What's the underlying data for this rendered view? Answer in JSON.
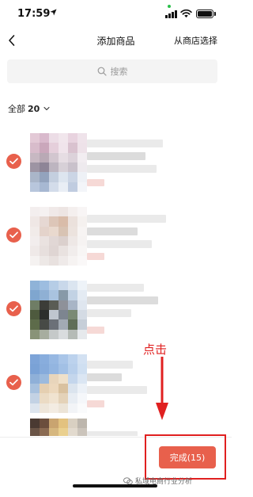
{
  "status_bar": {
    "time": "17:59"
  },
  "nav": {
    "title": "添加商品",
    "right_action": "从商店选择"
  },
  "search": {
    "placeholder": "搜索"
  },
  "filter": {
    "label": "全部",
    "count": "20"
  },
  "products": [
    {
      "selected": true,
      "thumb_colors": [
        "#e3c9d6",
        "#d9b9cc",
        "#ecdde6",
        "#f1e6ec",
        "#e8d3df",
        "#efe3ea",
        "#d8bccb",
        "#caa7bb",
        "#e5cfdb",
        "#f0e4eb",
        "#d9c2cf",
        "#eee2e9",
        "#c7b8c2",
        "#b9a9b5",
        "#d2c6cf",
        "#e6dde3",
        "#dcd2da",
        "#f2edf1",
        "#9d94a3",
        "#8e8597",
        "#bdb5c0",
        "#d7d0d7",
        "#c9c1cb",
        "#eeeaee",
        "#aab6c9",
        "#93a3bd",
        "#c4cfdf",
        "#dde5ef",
        "#cbd5e5",
        "#eef1f6",
        "#b8c6dc",
        "#a7b8d2",
        "#d3dcea",
        "#e9eef5",
        "#c0cce0",
        "#f3f5f9"
      ]
    },
    {
      "selected": true,
      "thumb_colors": [
        "#f3eeee",
        "#f5f1f1",
        "#f0e9e8",
        "#ede5e3",
        "#f4efee",
        "#f8f5f5",
        "#efe7e5",
        "#e6d8d3",
        "#ddc6b8",
        "#d9bca9",
        "#ebe1dc",
        "#f5f1ef",
        "#f1ebe9",
        "#e4d3cb",
        "#e9d9ce",
        "#d8c3b3",
        "#ece3de",
        "#f7f4f3",
        "#f2eded",
        "#eae2e0",
        "#e1d7d5",
        "#dbd0cd",
        "#eee8e6",
        "#f6f3f2",
        "#efe9e8",
        "#e7dfdd",
        "#dfd5d3",
        "#e9e2e0",
        "#f1edec",
        "#f8f6f5",
        "#f5f2f1",
        "#ede8e6",
        "#e8e1df",
        "#efeae9",
        "#f6f3f2",
        "#faf8f8"
      ]
    },
    {
      "selected": true,
      "thumb_colors": [
        "#8fb3d8",
        "#9dbde0",
        "#b6cde6",
        "#c9d8ea",
        "#dbe5f0",
        "#eef3f8",
        "#7fa6cf",
        "#8fb0d4",
        "#a9c3df",
        "#8799a8",
        "#c2d2e4",
        "#e4ebf3",
        "#6f7d65",
        "#3c3d38",
        "#5a5c55",
        "#8e9199",
        "#a8b5c6",
        "#dfe6ef",
        "#4e5a3e",
        "#2b2e2c",
        "#bfc6cf",
        "#7d8590",
        "#7a8a75",
        "#d4dbe4",
        "#5d6b4a",
        "#474a46",
        "#6b7078",
        "#a2aab4",
        "#5f6e58",
        "#c6ced8",
        "#899378",
        "#a7ad9f",
        "#c5c9c9",
        "#d9dcde",
        "#b5bbb6",
        "#e6e9ec"
      ]
    },
    {
      "selected": true,
      "thumb_colors": [
        "#7da4d8",
        "#88addd",
        "#97b8e2",
        "#a9c5e8",
        "#bcd2ed",
        "#d3e1f2",
        "#7aa2d6",
        "#86abdb",
        "#93b5e0",
        "#a2c0e5",
        "#b8cfeb",
        "#cfdff1",
        "#8fb0d8",
        "#9cbadd",
        "#e8d5bb",
        "#efe0c9",
        "#c4d6ec",
        "#dbe6f3",
        "#a8c1de",
        "#e5cfb1",
        "#ecd8bd",
        "#d9c19f",
        "#dbe4ee",
        "#ecf1f7",
        "#c3d2e4",
        "#ebdbc4",
        "#f0e3d0",
        "#e4d2b8",
        "#e8edf3",
        "#f5f7fa",
        "#dde5ee",
        "#eee6da",
        "#f3ece2",
        "#ece4d7",
        "#f2f4f7",
        "#fafbfc"
      ]
    },
    {
      "selected": false,
      "thumb_colors": [
        "#4a3a32",
        "#6b4e3d",
        "#c9a470",
        "#e3c27f",
        "#d9d0c2",
        "#bdb6ad",
        "#6a5446",
        "#8a6a52",
        "#d6b77f",
        "#ead08f",
        "#e2dace",
        "#cbc4bb",
        "#f0ece7",
        "#f3f0ec",
        "#f5f2ef",
        "#f7f5f2",
        "#f8f6f4",
        "#faf9f7",
        "#f0ece7",
        "#f3f0ec",
        "#f5f2ef",
        "#f7f5f2",
        "#f8f6f4",
        "#faf9f7",
        "#f0ece7",
        "#f3f0ec",
        "#f5f2ef",
        "#f7f5f2",
        "#f8f6f4",
        "#faf9f7",
        "#f0ece7",
        "#f3f0ec",
        "#f5f2ef",
        "#f7f5f2",
        "#f8f6f4",
        "#faf9f7"
      ]
    }
  ],
  "done_button": {
    "label": "完成(15)"
  },
  "annotation": {
    "text": "点击"
  },
  "watermark": {
    "text": "私域电商行业分析"
  },
  "colors": {
    "accent": "#e8604c",
    "annotation_red": "#e02020"
  }
}
